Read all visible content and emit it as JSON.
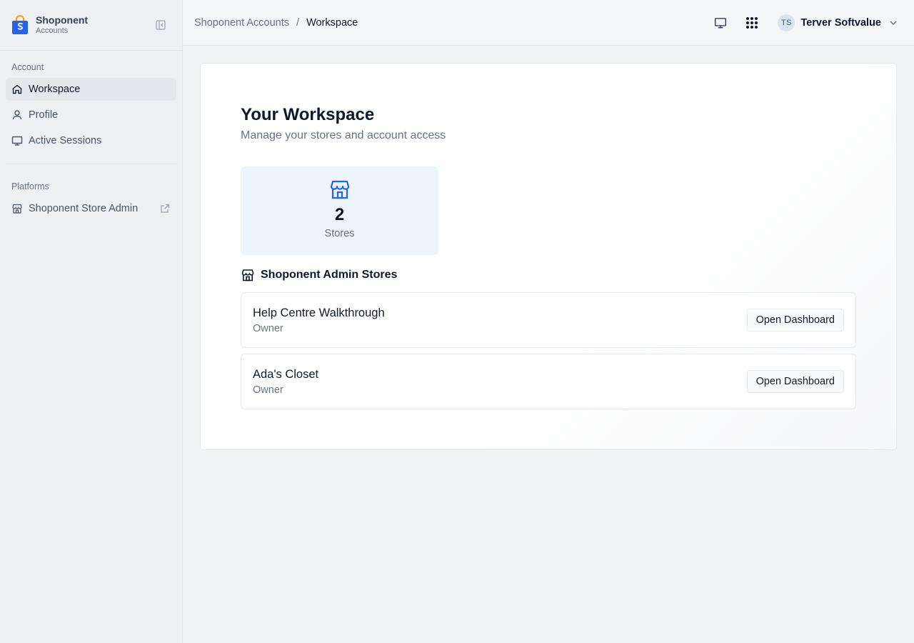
{
  "brand": {
    "name": "Shoponent",
    "subtitle": "Accounts"
  },
  "sidebar": {
    "sections": [
      {
        "label": "Account",
        "items": [
          {
            "label": "Workspace",
            "icon": "home-icon",
            "active": true
          },
          {
            "label": "Profile",
            "icon": "user-icon",
            "active": false
          },
          {
            "label": "Active Sessions",
            "icon": "monitor-icon",
            "active": false
          }
        ]
      },
      {
        "label": "Platforms",
        "items": [
          {
            "label": "Shoponent Store Admin",
            "icon": "store-icon",
            "active": false,
            "external": true
          }
        ]
      }
    ]
  },
  "header": {
    "breadcrumb": {
      "parent": "Shoponent Accounts",
      "separator": "/",
      "current": "Workspace"
    },
    "user": {
      "initials": "TS",
      "name": "Terver Softvalue"
    }
  },
  "main": {
    "title": "Your Workspace",
    "subtitle": "Manage your stores and account access",
    "stat": {
      "value": "2",
      "label": "Stores"
    },
    "stores_heading": "Shoponent Admin Stores",
    "stores": [
      {
        "name": "Help Centre Walkthrough",
        "role": "Owner",
        "action": "Open Dashboard"
      },
      {
        "name": "Ada's Closet",
        "role": "Owner",
        "action": "Open Dashboard"
      }
    ]
  },
  "colors": {
    "accent": "#2563eb",
    "sidebar_bg": "#eef0f3",
    "stat_bg": "#eef4fc"
  }
}
